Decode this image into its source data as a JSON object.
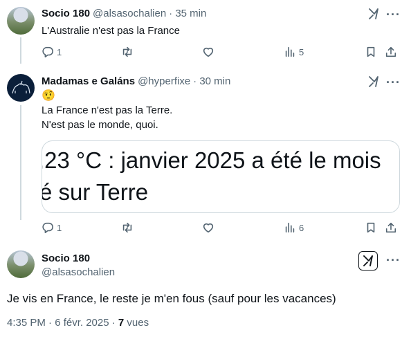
{
  "tweet1": {
    "name": "Socio 180",
    "handle": "@alsasochalien",
    "time": "· 35 min",
    "text": "L'Australie n'est pas la France",
    "replies": "1",
    "views": "5"
  },
  "tweet2": {
    "name": "Madamas e Galáns",
    "handle": "@hyperfixe",
    "time": "· 30 min",
    "emoji": "🤨",
    "text_line1": "La France n'est pas la Terre.",
    "text_line2": "N'est pas le monde, quoi.",
    "card_line1": ",23 °C : janvier 2025 a été le mois",
    "card_line2": "é sur Terre",
    "replies": "1",
    "views": "6"
  },
  "main": {
    "name": "Socio 180",
    "handle": "@alsasochalien",
    "text": "Je vis en France,  le reste je m'en fous (sauf pour les vacances)",
    "timestamp": "4:35 PM · 6 févr. 2025 · ",
    "views_count": "7",
    "views_label": " vues"
  },
  "icons": {
    "reply": "reply-icon",
    "retweet": "retweet-icon",
    "like": "heart-icon",
    "views": "views-icon",
    "bookmark": "bookmark-icon",
    "share": "share-icon",
    "grok": "grok-icon",
    "more": "more-icon"
  },
  "colors": {
    "text": "#0f1419",
    "secondary": "#536471",
    "border": "#cfd9de"
  }
}
